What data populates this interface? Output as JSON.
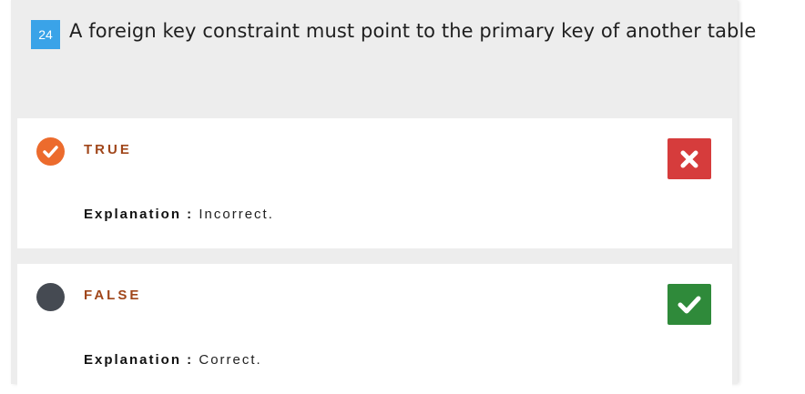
{
  "question": {
    "number": "24",
    "text": "A foreign key constraint must point to the primary key of another table"
  },
  "options": [
    {
      "label": "TRUE",
      "selected": true,
      "explanation_key": "Explanation :",
      "explanation_value": "Incorrect.",
      "status_icon": "close-icon",
      "status_color": "#d63c3c"
    },
    {
      "label": "FALSE",
      "selected": false,
      "explanation_key": "Explanation :",
      "explanation_value": "Correct.",
      "status_icon": "check-icon",
      "status_color": "#2f8a3a"
    }
  ],
  "colors": {
    "accent_number": "#3aa3e8",
    "selected_radio": "#ec6b2d",
    "unselected_radio": "#454a52",
    "option_label": "#a0461a"
  }
}
